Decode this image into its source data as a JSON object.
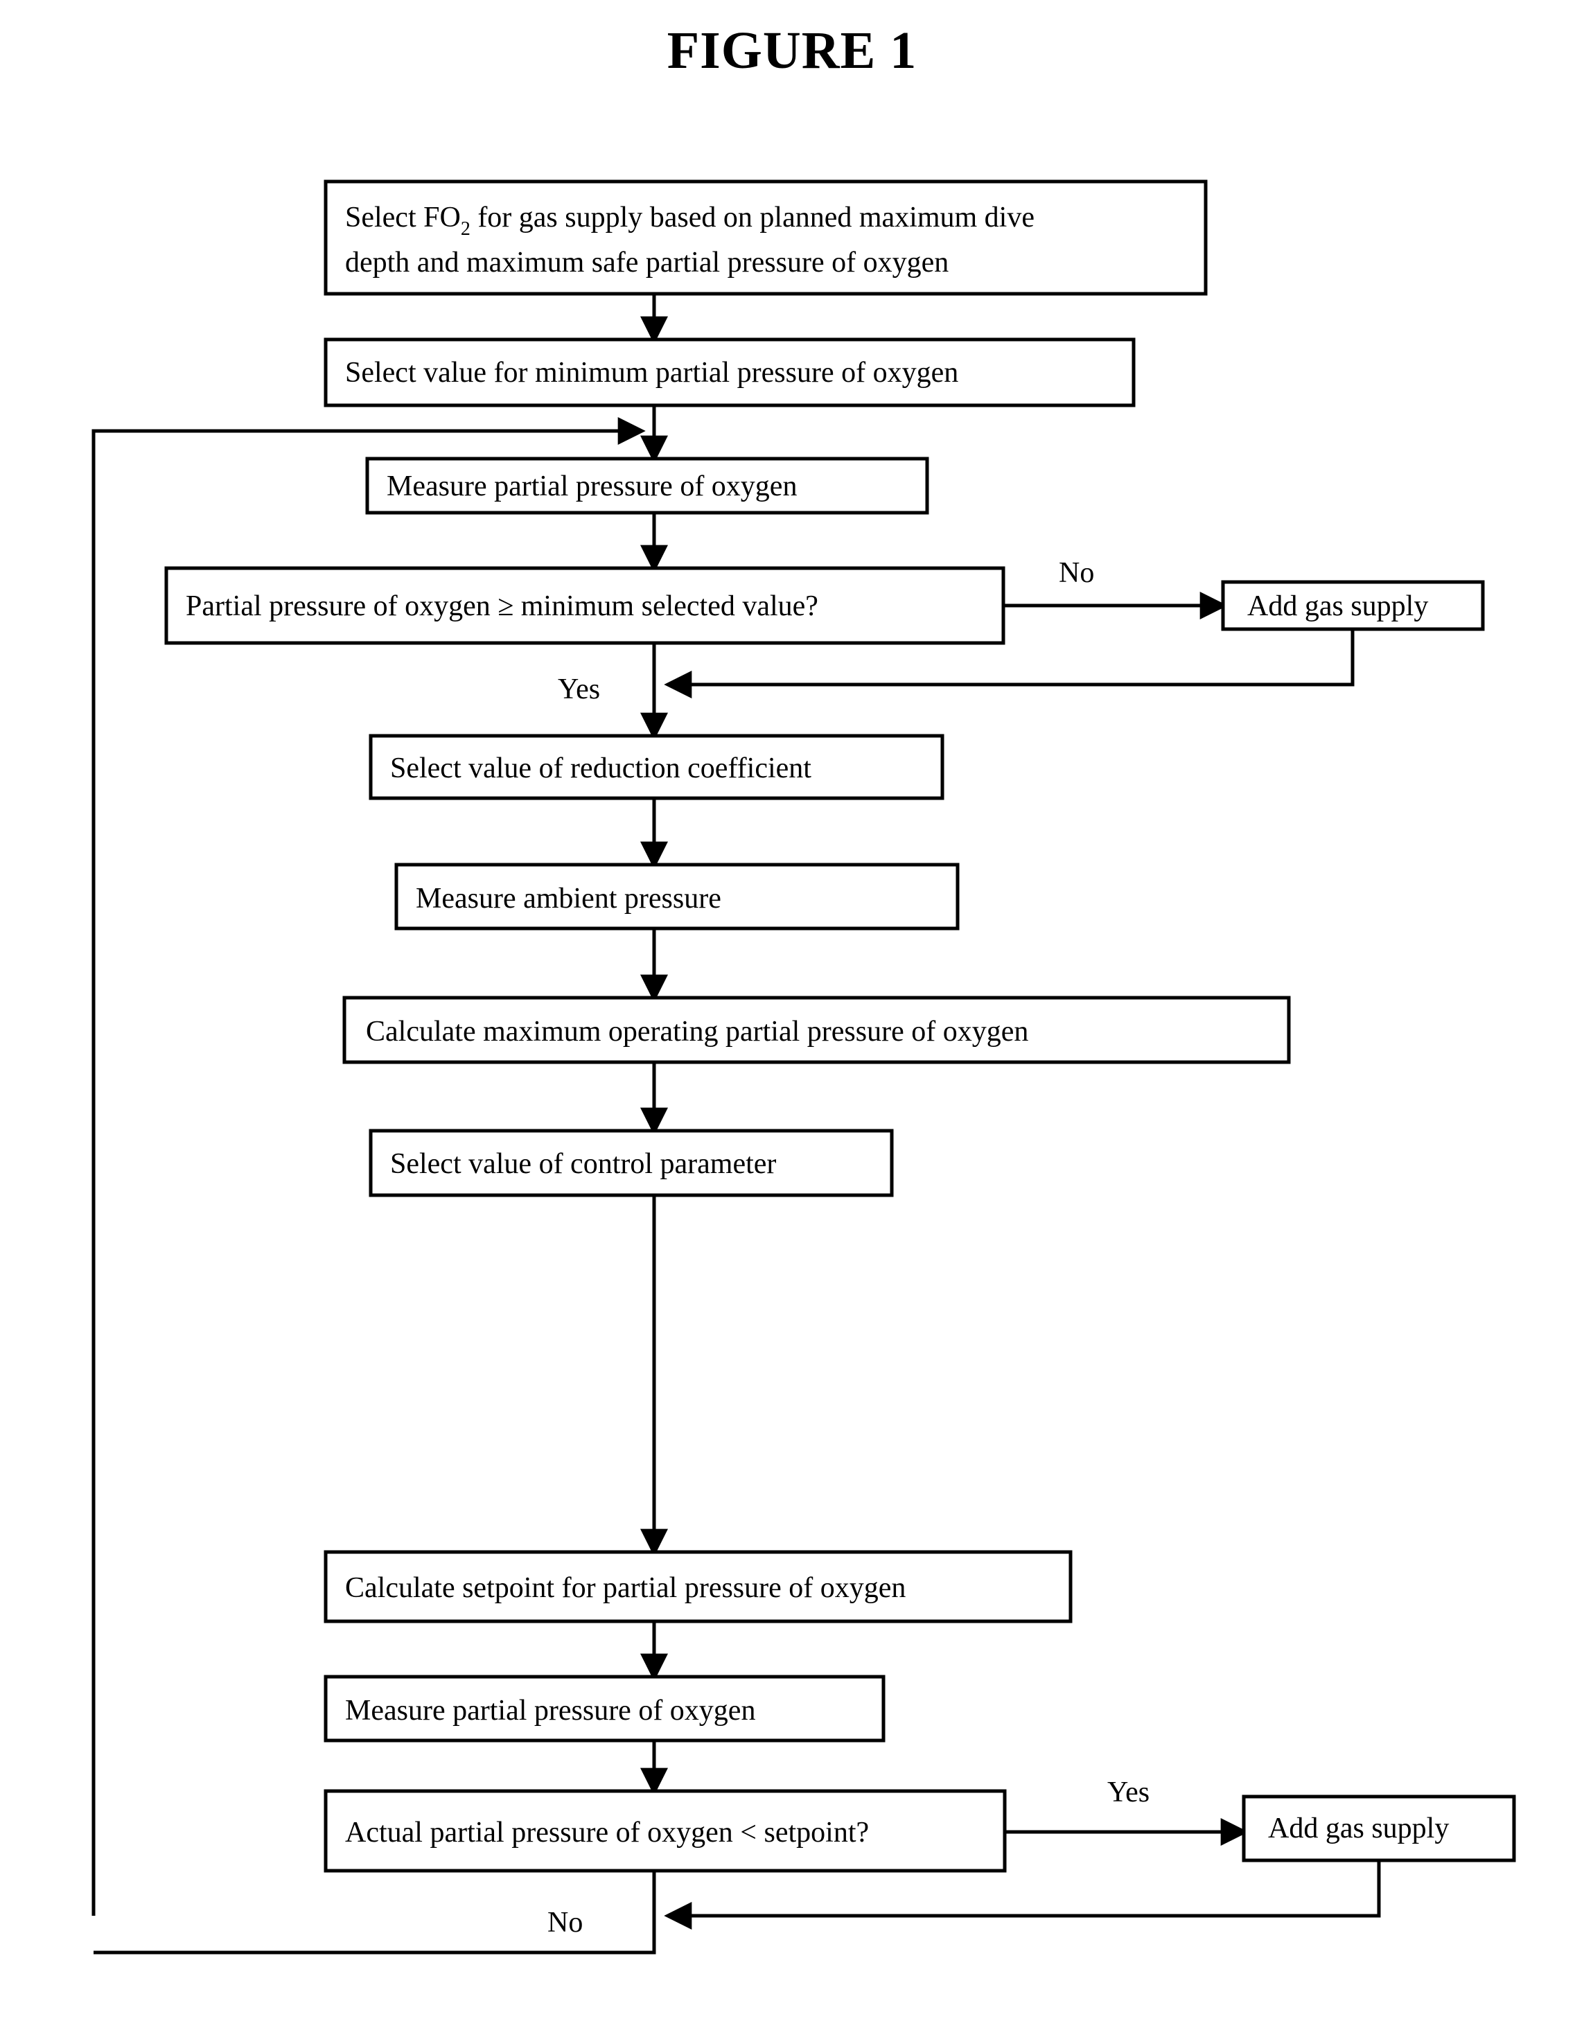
{
  "figure": {
    "title": "FIGURE 1"
  },
  "flowchart": {
    "nodes": [
      {
        "id": "select-fo2",
        "line1": "Select FO",
        "sub1": "2",
        "line1b": " for gas supply based on planned maximum dive",
        "line2": "depth and maximum safe partial pressure of oxygen",
        "type": "process"
      },
      {
        "id": "select-min-ppo2",
        "label": "Select value for minimum partial pressure of oxygen",
        "type": "process"
      },
      {
        "id": "measure-ppo2-1",
        "label": "Measure partial pressure of oxygen",
        "type": "process"
      },
      {
        "id": "decision-min-check",
        "label": "Partial pressure of oxygen ≥ minimum selected value?",
        "type": "decision"
      },
      {
        "id": "add-gas-supply-1",
        "label": "Add gas supply",
        "type": "process"
      },
      {
        "id": "select-reduction-coefficient",
        "label": "Select value of reduction coefficient",
        "type": "process"
      },
      {
        "id": "measure-ambient-pressure",
        "label": "Measure ambient pressure",
        "type": "process"
      },
      {
        "id": "calculate-max-operating",
        "label": "Calculate maximum operating partial pressure of oxygen",
        "type": "process"
      },
      {
        "id": "select-control-parameter",
        "label": "Select value of control parameter",
        "type": "process"
      },
      {
        "id": "calculate-setpoint",
        "label": "Calculate setpoint for partial pressure of oxygen",
        "type": "process"
      },
      {
        "id": "measure-ppo2-2",
        "label": "Measure partial pressure of oxygen",
        "type": "process"
      },
      {
        "id": "decision-setpoint-check",
        "label": "Actual partial pressure of oxygen < setpoint?",
        "type": "decision"
      },
      {
        "id": "add-gas-supply-2",
        "label": "Add gas supply",
        "type": "process"
      }
    ],
    "edge_labels": {
      "decision1_no": "No",
      "decision1_yes": "Yes",
      "decision2_yes": "Yes",
      "decision2_no": "No"
    }
  },
  "colors": {
    "stroke": "#000000",
    "fill": "#ffffff",
    "background": "#ffffff"
  }
}
